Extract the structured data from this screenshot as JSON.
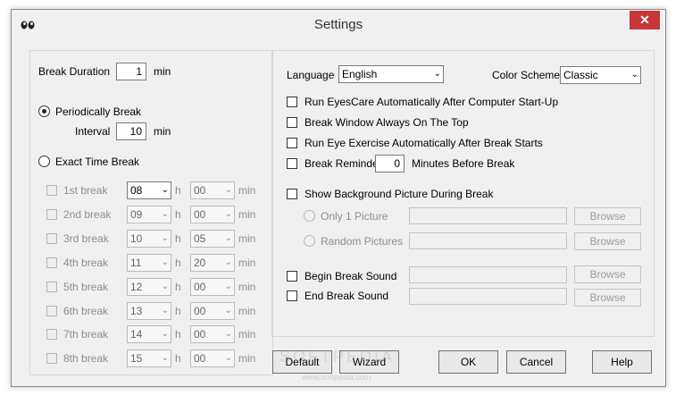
{
  "window": {
    "title": "Settings",
    "close_label": "✕"
  },
  "left": {
    "break_duration_label": "Break Duration",
    "break_duration_value": "1",
    "min_label": "min",
    "periodic_label": "Periodically Break",
    "interval_label": "Interval",
    "interval_value": "10",
    "exact_label": "Exact Time Break",
    "h_label": "h",
    "rows": [
      {
        "label": "1st break",
        "hour": "08",
        "minute": "00"
      },
      {
        "label": "2nd break",
        "hour": "09",
        "minute": "00"
      },
      {
        "label": "3rd break",
        "hour": "10",
        "minute": "05"
      },
      {
        "label": "4th break",
        "hour": "11",
        "minute": "20"
      },
      {
        "label": "5th break",
        "hour": "12",
        "minute": "00"
      },
      {
        "label": "6th break",
        "hour": "13",
        "minute": "00"
      },
      {
        "label": "7th break",
        "hour": "14",
        "minute": "00"
      },
      {
        "label": "8th break",
        "hour": "15",
        "minute": "00"
      }
    ]
  },
  "right": {
    "language_label": "Language",
    "language_value": "English",
    "scheme_label": "Color Scheme",
    "scheme_value": "Classic",
    "opt_autostart": "Run EyesCare Automatically After Computer Start-Up",
    "opt_ontop": "Break Window Always On The Top",
    "opt_exercise": "Run Eye Exercise Automatically After Break Starts",
    "opt_reminder": "Break Reminder",
    "reminder_value": "0",
    "reminder_suffix": "Minutes Before Break",
    "opt_background": "Show Background Picture During Break",
    "only_one": "Only 1 Picture",
    "random": "Random Pictures",
    "browse": "Browse",
    "begin_sound": "Begin Break Sound",
    "end_sound": "End Break Sound"
  },
  "buttons": {
    "default": "Default",
    "wizard": "Wizard",
    "ok": "OK",
    "cancel": "Cancel",
    "help": "Help"
  },
  "watermark": {
    "text": "SOFTPEDIA",
    "url": "www.softpedia.com"
  },
  "colors": {
    "close": "#c7373a",
    "background": "#f0f0f0"
  }
}
